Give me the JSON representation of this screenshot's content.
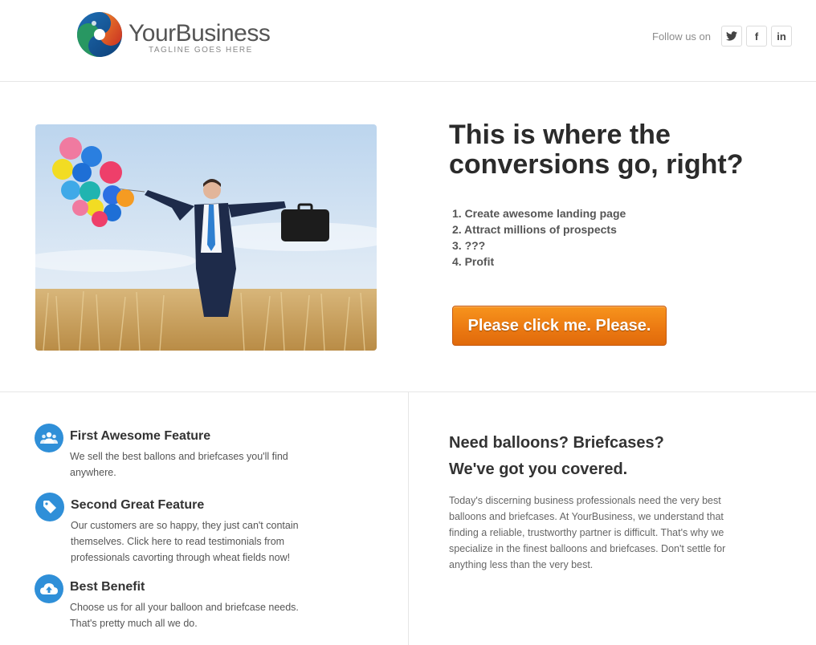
{
  "header": {
    "logo_name": "YourBusiness",
    "logo_tagline": "TAGLINE GOES HERE",
    "follow_label": "Follow us on",
    "social": [
      {
        "name": "twitter-icon",
        "glyph": "t"
      },
      {
        "name": "facebook-icon",
        "glyph": "f"
      },
      {
        "name": "linkedin-icon",
        "glyph": "in"
      }
    ]
  },
  "hero": {
    "title": "This is where the conversions go, right?",
    "steps": [
      "1. Create awesome landing page",
      "2. Attract millions of prospects",
      "3. ???",
      "4. Profit"
    ],
    "cta_label": "Please click me. Please."
  },
  "features": [
    {
      "icon": "users-icon",
      "title": "First Awesome Feature",
      "text": "We sell the best ballons and briefcases you'll find anywhere."
    },
    {
      "icon": "tag-icon",
      "title": "Second Great Feature",
      "text": "Our customers are so happy, they just can't contain themselves. Click here to read testimonials from professionals cavorting through wheat fields now!"
    },
    {
      "icon": "cloud-upload-icon",
      "title": "Best Benefit",
      "text": "Choose us for all your balloon and briefcase needs. That's pretty much all we do."
    }
  ],
  "side": {
    "heading_1": "Need balloons? Briefcases?",
    "heading_2": "We've got you covered.",
    "body": "Today's discerning business professionals need the very best balloons and briefcases. At YourBusiness, we understand that finding a reliable, trustworthy partner is difficult. That's why we specialize in the finest balloons and briefcases. Don't settle for anything less than the very best."
  },
  "colors": {
    "cta": "#ec7a12",
    "feature_icon": "#2f8fd8",
    "logo_blue": "#1f6fb5",
    "logo_red": "#d9452b",
    "logo_green": "#2a9d5b"
  }
}
